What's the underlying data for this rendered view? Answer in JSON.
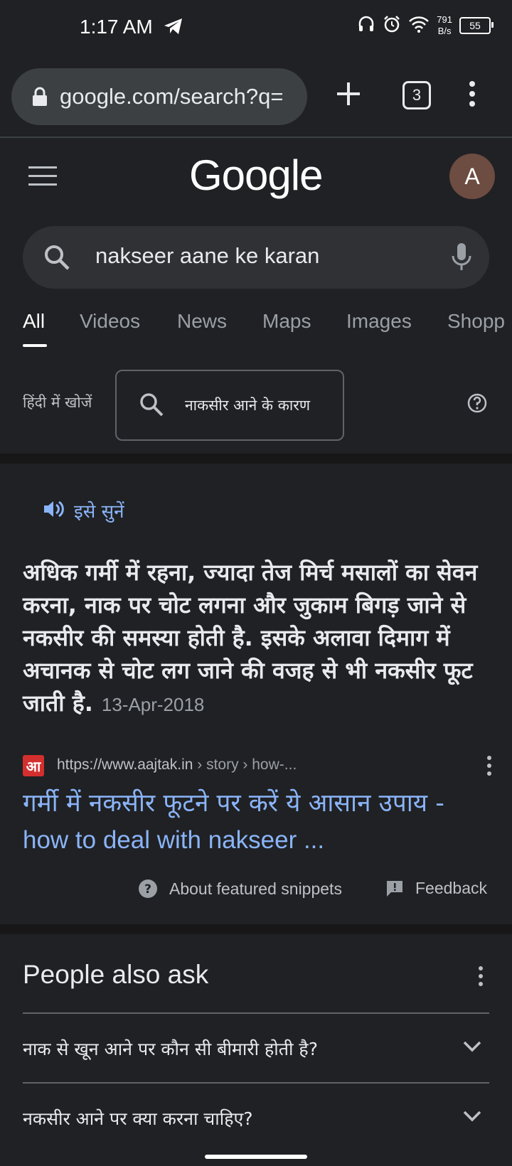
{
  "status": {
    "time": "1:17 AM",
    "net_speed_value": "791",
    "net_speed_unit": "B/s",
    "battery": "55"
  },
  "browser": {
    "url": "google.com/search?q=",
    "tab_count": "3"
  },
  "google": {
    "logo": "Google",
    "avatar_letter": "A",
    "query": "nakseer aane ke karan",
    "tabs": [
      "All",
      "Videos",
      "News",
      "Maps",
      "Images",
      "Shopp"
    ],
    "active_tab": "All",
    "hindi_label": "हिंदी में खोजें",
    "hindi_query": "नाकसीर आने के कारण"
  },
  "featured": {
    "listen_label": "इसे सुनें",
    "snippet_text": "अधिक गर्मी में रहना, ज्यादा तेज मिर्च मसालों का सेवन करना, नाक पर चोट लगना और जुकाम बिगड़ जाने से नकसीर की समस्या होती है. इसके अलावा दिमाग में अचानक से चोट लग जाने की वजह से भी नकसीर फूट जाती है.",
    "date": "13-Apr-2018",
    "favicon_text": "आ",
    "source_domain": "https://www.aajtak.in",
    "source_path": " › story › how-...",
    "title_hindi": "गर्मी में नकसीर फूटने पर करें ये आसान उपाय -",
    "title_english": "how to deal with nakseer ...",
    "about_label": "About featured snippets",
    "feedback_label": "Feedback"
  },
  "people_also_ask": {
    "title": "People also ask",
    "questions": [
      "नाक से खून आने पर कौन सी बीमारी होती है?",
      "नकसीर आने पर क्या करना चाहिए?"
    ]
  }
}
